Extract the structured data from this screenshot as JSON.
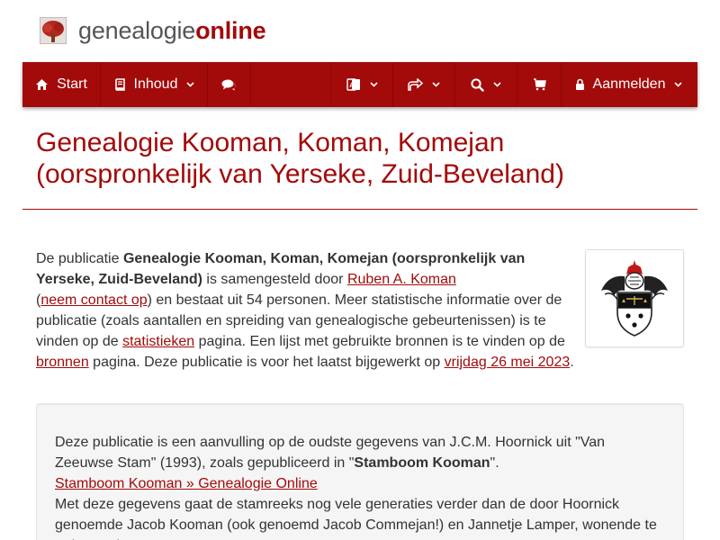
{
  "logo": {
    "part1": "genealogie",
    "part2": "online"
  },
  "nav": {
    "start": "Start",
    "inhoud": "Inhoud",
    "login": "Aanmelden"
  },
  "title": "Genealogie Kooman, Koman, Komejan (oorspronkelijk van Yerseke, Zuid-Beveland)",
  "intro": {
    "t1": "De publicatie ",
    "pub": "Genealogie Kooman, Koman, Komejan (oorspronkelijk van Yerseke, Zuid-Beveland)",
    "t2": " is samengesteld door ",
    "author": "Ruben A. Koman",
    "t3": "(",
    "contact": "neem contact op",
    "t4": ") en bestaat uit 54 personen. Meer statistische informatie over de publicatie (zoals aantallen en spreiding van genealogische gebeurtenissen) is te vinden op de ",
    "stats": "statistieken",
    "t5": " pagina. Een lijst met gebruikte bronnen is te vinden op de ",
    "sources": "bronnen",
    "t6": " pagina. Deze publicatie is voor het laatst bijgewerkt op ",
    "date": "vrijdag 26 mei 2023",
    "t7": "."
  },
  "panel": {
    "p1a": "Deze publicatie is een aanvulling op de oudste gegevens van J.C.M. Hoornick uit \"Van Zeeuwse Stam\" (1993), zoals gepubliceerd in \"",
    "p1b": "Stamboom Kooman",
    "p1c": "\".",
    "link": "Stamboom Kooman » Genealogie Online",
    "p2": "Met deze gegevens gaat de stamreeks nog vele generaties verder dan de door Hoornick genoemde Jacob Kooman (ook genoemd Jacob Commejan!) en Jannetje Lamper, wonende te Scherpenisse."
  },
  "icons": {
    "start": "home-icon",
    "inhoud": "book-icon",
    "chat": "comments-icon",
    "language": "language-icon",
    "share": "share-icon",
    "search": "search-icon",
    "cart": "cart-icon",
    "login": "lock-icon"
  },
  "colors": {
    "brand": "#a30a0a",
    "text": "#333333",
    "panel": "#f5f5f5"
  }
}
